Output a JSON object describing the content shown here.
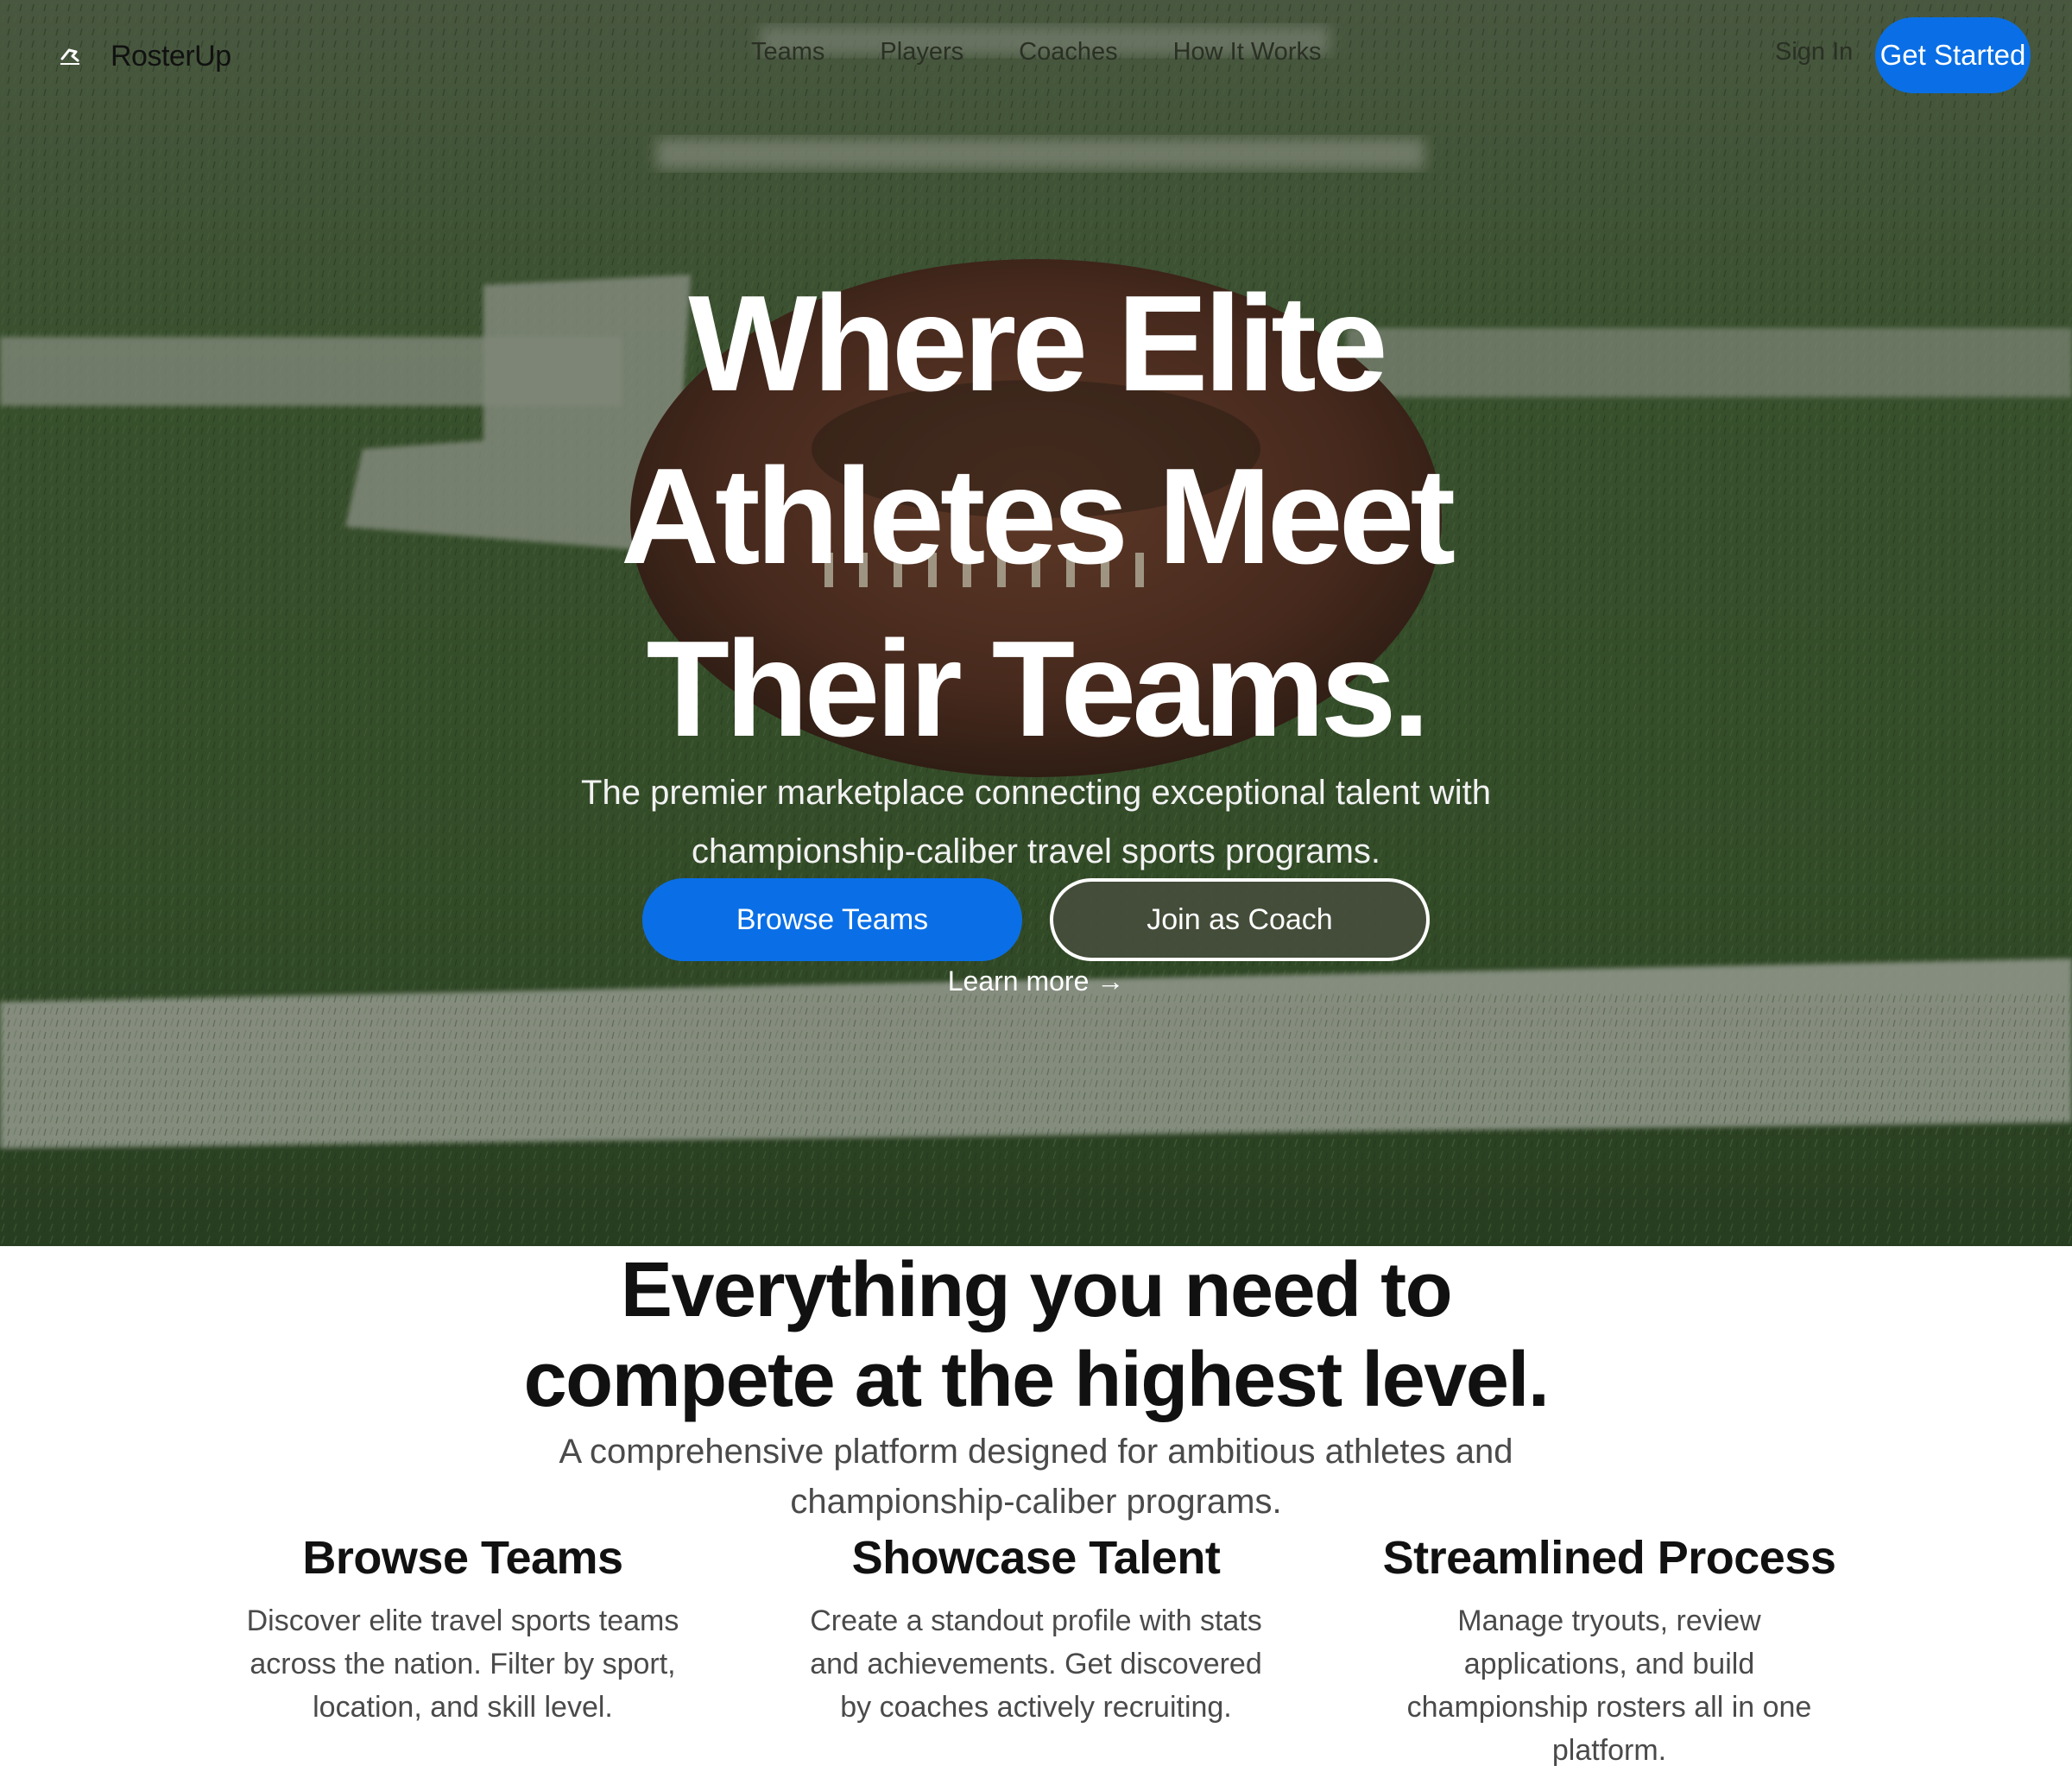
{
  "brand": {
    "name": "RosterUp",
    "logo_icon": "runner-logo-icon"
  },
  "nav": {
    "links": [
      "Teams",
      "Players",
      "Coaches",
      "How It Works"
    ],
    "sign_in": "Sign In",
    "get_started": "Get Started"
  },
  "hero": {
    "title_lines": [
      "Where Elite",
      "Athletes Meet",
      "Their Teams."
    ],
    "subtitle_lines": [
      "The premier marketplace connecting exceptional talent with",
      "championship-caliber travel sports programs."
    ],
    "primary_cta": "Browse Teams",
    "secondary_cta": "Join as Coach",
    "learn_more": "Learn more →",
    "background": "football-on-turf-photo"
  },
  "features": {
    "title_lines": [
      "Everything you need to",
      "compete at the highest level."
    ],
    "subtitle_lines": [
      "A comprehensive platform designed for ambitious athletes and",
      "championship-caliber programs."
    ],
    "items": [
      {
        "title": "Browse Teams",
        "lines": [
          "Discover elite travel sports teams",
          "across the nation. Filter by sport,",
          "location, and skill level."
        ]
      },
      {
        "title": "Showcase Talent",
        "lines": [
          "Create a standout profile with stats",
          "and achievements. Get discovered",
          "by coaches actively recruiting."
        ]
      },
      {
        "title": "Streamlined Process",
        "lines": [
          "Manage tryouts, review",
          "applications, and build",
          "championship rosters all in one",
          "platform."
        ]
      }
    ]
  },
  "colors": {
    "accent": "#0a6fe6",
    "turf": "#3a5530",
    "text_dark": "#111111",
    "text_muted": "#4a4a4a"
  }
}
